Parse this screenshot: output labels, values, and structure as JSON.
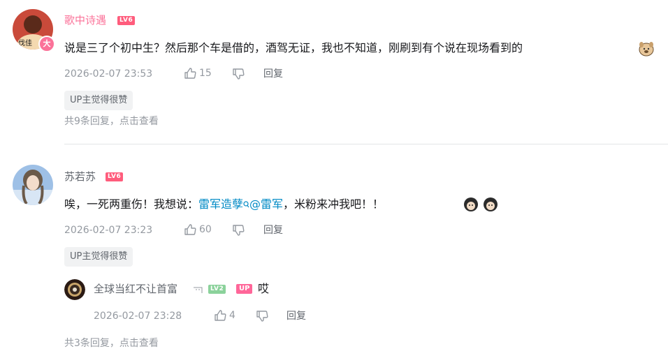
{
  "comments": [
    {
      "username": "歌中诗遇",
      "level": "LV6",
      "avatar_badge": "大",
      "content": "说是三了个初中生？然后那个车是借的，酒驾无证，我也不知道，刚刷到有个说在现场看到的",
      "emoji": "dog-emoji",
      "time": "2026-02-07 23:53",
      "likes": "15",
      "reply_label": "回复",
      "tag": "UP主觉得很赞",
      "more_replies": "共9条回复，点击查看"
    },
    {
      "username": "苏若苏",
      "level": "LV6",
      "content_prefix": "唉，一死两重伤！我想说：",
      "link1": "雷军造孽",
      "link2": "@雷军",
      "content_suffix": "，米粉来冲我吧！！",
      "time": "2026-02-07 23:23",
      "likes": "60",
      "reply_label": "回复",
      "tag": "UP主觉得很赞",
      "reply": {
        "username": "全球当红不让首富",
        "level": "LV2",
        "up_badge": "UP",
        "content": "哎",
        "time": "2026-02-07 23:28",
        "likes": "4",
        "reply_label": "回复"
      },
      "more_replies": "共3条回复，点击查看"
    }
  ],
  "colors": {
    "username_pink": "#fb7299",
    "username_gray": "#61666d",
    "link_blue": "#008ac5",
    "meta_gray": "#9499a0"
  }
}
